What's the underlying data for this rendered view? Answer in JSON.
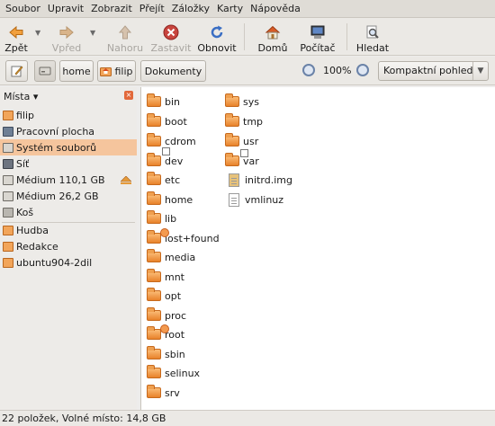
{
  "menubar": {
    "items": [
      "Soubor",
      "Upravit",
      "Zobrazit",
      "Přejít",
      "Záložky",
      "Karty",
      "Nápověda"
    ]
  },
  "toolbar": {
    "back_label": "Zpět",
    "forward_label": "Vpřed",
    "up_label": "Nahoru",
    "stop_label": "Zastavit",
    "reload_label": "Obnovit",
    "home_label": "Domů",
    "computer_label": "Počítač",
    "search_label": "Hledat"
  },
  "location": {
    "crumbs": [
      "home",
      "filip",
      "Dokumenty"
    ],
    "zoom": "100%",
    "view_mode": "Kompaktní pohled"
  },
  "sidebar": {
    "header": "Místa",
    "items": [
      "filip",
      "Pracovní plocha",
      "Systém souborů",
      "Síť",
      "Médium 110,1 GB",
      "Médium 26,2 GB",
      "Koš"
    ],
    "bookmarks": [
      "Hudba",
      "Redakce",
      "ubuntu904-2dil"
    ]
  },
  "files": {
    "col1": [
      "bin",
      "boot",
      "cdrom",
      "dev",
      "etc",
      "home",
      "lib",
      "lost+found",
      "media",
      "mnt",
      "opt",
      "proc",
      "root",
      "sbin",
      "selinux",
      "srv"
    ],
    "col2": [
      "sys",
      "tmp",
      "usr",
      "var",
      "initrd.img",
      "vmlinuz"
    ]
  },
  "status": {
    "text": "22 položek, Volné místo: 14,8 GB"
  },
  "colors": {
    "folder": "#e8822a",
    "selection": "#f5c59d"
  }
}
